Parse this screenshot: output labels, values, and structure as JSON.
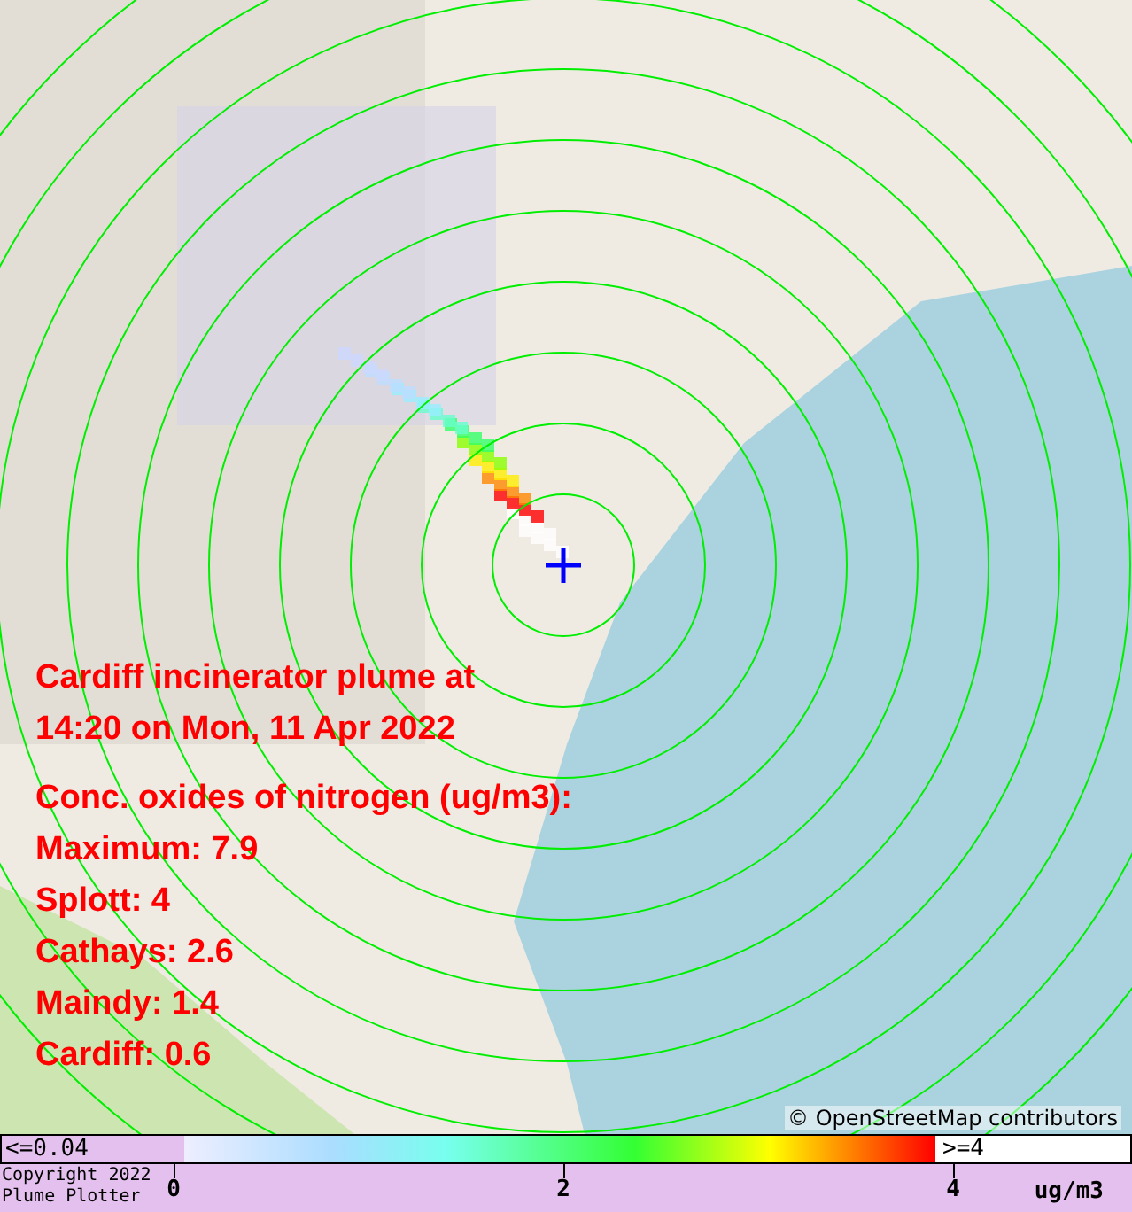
{
  "overlay": {
    "title_lines": [
      "Cardiff incinerator plume at",
      "14:20 on Mon, 11 Apr 2022"
    ],
    "heading": "Conc. oxides of nitrogen (ug/m3):",
    "readings": [
      "Maximum: 7.9",
      "Splott: 4",
      "Cathays: 2.6",
      "Maindy: 1.4",
      "Cardiff: 0.6"
    ]
  },
  "attribution": "© OpenStreetMap contributors",
  "legend": {
    "low_label": "<=0.04",
    "high_label": ">=4",
    "ticks": [
      "0",
      "2",
      "4"
    ],
    "unit": "ug/m3"
  },
  "footer": {
    "lines": [
      "Copyright 2022",
      "Plume Plotter"
    ]
  }
}
